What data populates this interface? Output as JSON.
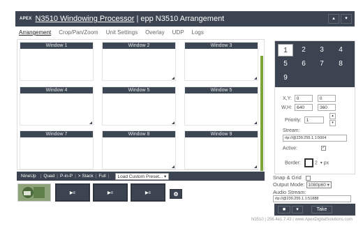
{
  "header": {
    "logo_text": "APEX",
    "title_link": "N3510 Windowing Processor",
    "title_rest": " | epp N3510   Arrangement",
    "btn_up": "▴",
    "btn_down": "▾"
  },
  "tabs": [
    "Arrangement",
    "Crop/Pan/Zoom",
    "Unit Settings",
    "Overlay",
    "UDP",
    "Logs"
  ],
  "windows": [
    {
      "label": "Window 1"
    },
    {
      "label": "Window 2"
    },
    {
      "label": "Window 3"
    },
    {
      "label": "Window 4"
    },
    {
      "label": "Window 5"
    },
    {
      "label": "Window 5"
    },
    {
      "label": "Window 7"
    },
    {
      "label": "Window 8"
    },
    {
      "label": "Window 9"
    }
  ],
  "bottombar": {
    "layouts": [
      "NineUp",
      "Quad",
      "P-in-P",
      "> Stack",
      "Full"
    ],
    "load_preset": "Load Custom Preset...",
    "load_arrow": "▾"
  },
  "thumbnails": {
    "camera_label": "▶≡",
    "settings_icon": "⚙"
  },
  "numpad": [
    "1",
    "2",
    "3",
    "4",
    "5",
    "6",
    "7",
    "8",
    "9"
  ],
  "selected_window": "1",
  "fields": {
    "xy_label": "X,Y:",
    "x": "0",
    "y": "0",
    "wh_label": "W,H:",
    "w": "640",
    "h": "360",
    "priority_label": "Priority:",
    "priority": "1",
    "stream_label": "Stream:",
    "stream": "rtp://@239.255.1.1:5004",
    "active_label": "Active:",
    "border_label": "Border:",
    "border_value": "2",
    "border_unit": "px"
  },
  "below": {
    "snap_label": "Snap & Grid",
    "output_label": "Output Mode:",
    "output_value": "1080p60",
    "audio_label": "Audio Stream:",
    "audio_value": "rtp://@239.255.1.1:51888"
  },
  "actions": {
    "stop": "■",
    "dropdown": "▾",
    "take": "Take"
  },
  "footer": "N3510 | 256.4e1.7.43 | www.ApexDigitalSolutions.com"
}
